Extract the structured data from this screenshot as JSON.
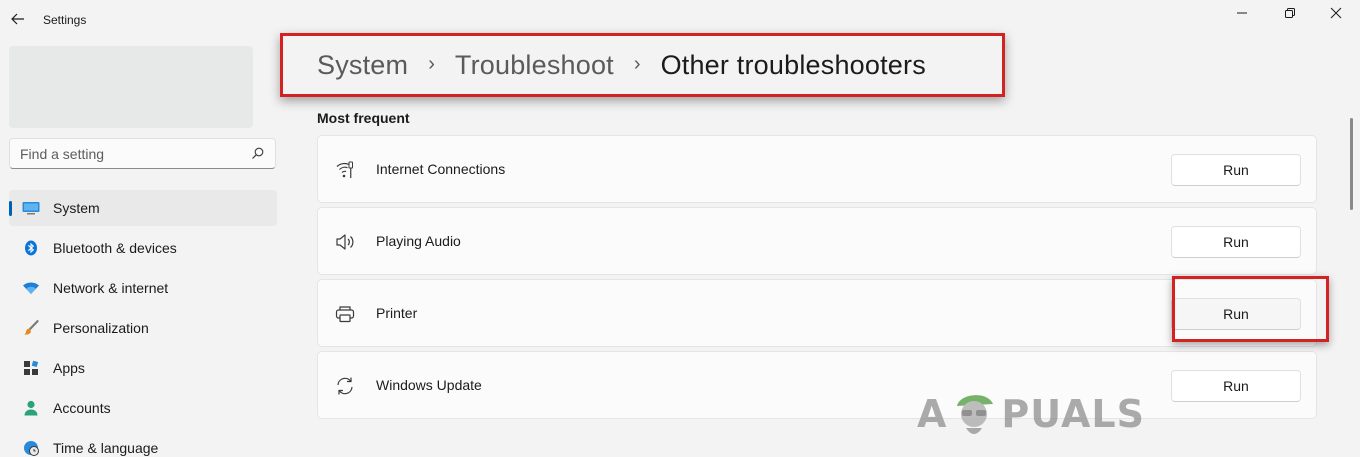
{
  "window": {
    "title": "Settings"
  },
  "sidebar": {
    "search_placeholder": "Find a setting",
    "items": [
      {
        "label": "System",
        "icon": "system-icon",
        "active": true
      },
      {
        "label": "Bluetooth & devices",
        "icon": "bluetooth-icon"
      },
      {
        "label": "Network & internet",
        "icon": "wifi-icon"
      },
      {
        "label": "Personalization",
        "icon": "brush-icon"
      },
      {
        "label": "Apps",
        "icon": "apps-icon"
      },
      {
        "label": "Accounts",
        "icon": "accounts-icon"
      },
      {
        "label": "Time & language",
        "icon": "globe-clock-icon"
      }
    ]
  },
  "breadcrumb": {
    "items": [
      "System",
      "Troubleshoot",
      "Other troubleshooters"
    ]
  },
  "main": {
    "section_title": "Most frequent",
    "troubleshooters": [
      {
        "label": "Internet Connections",
        "icon": "internet-connections-icon",
        "button": "Run"
      },
      {
        "label": "Playing Audio",
        "icon": "speaker-icon",
        "button": "Run"
      },
      {
        "label": "Printer",
        "icon": "printer-icon",
        "button": "Run"
      },
      {
        "label": "Windows Update",
        "icon": "sync-icon",
        "button": "Run"
      }
    ]
  },
  "watermark": {
    "text_left": "A",
    "text_right": "PUALS"
  },
  "colors": {
    "accent": "#005fb8",
    "highlight": "#d32222",
    "background": "#f3f3f3"
  }
}
